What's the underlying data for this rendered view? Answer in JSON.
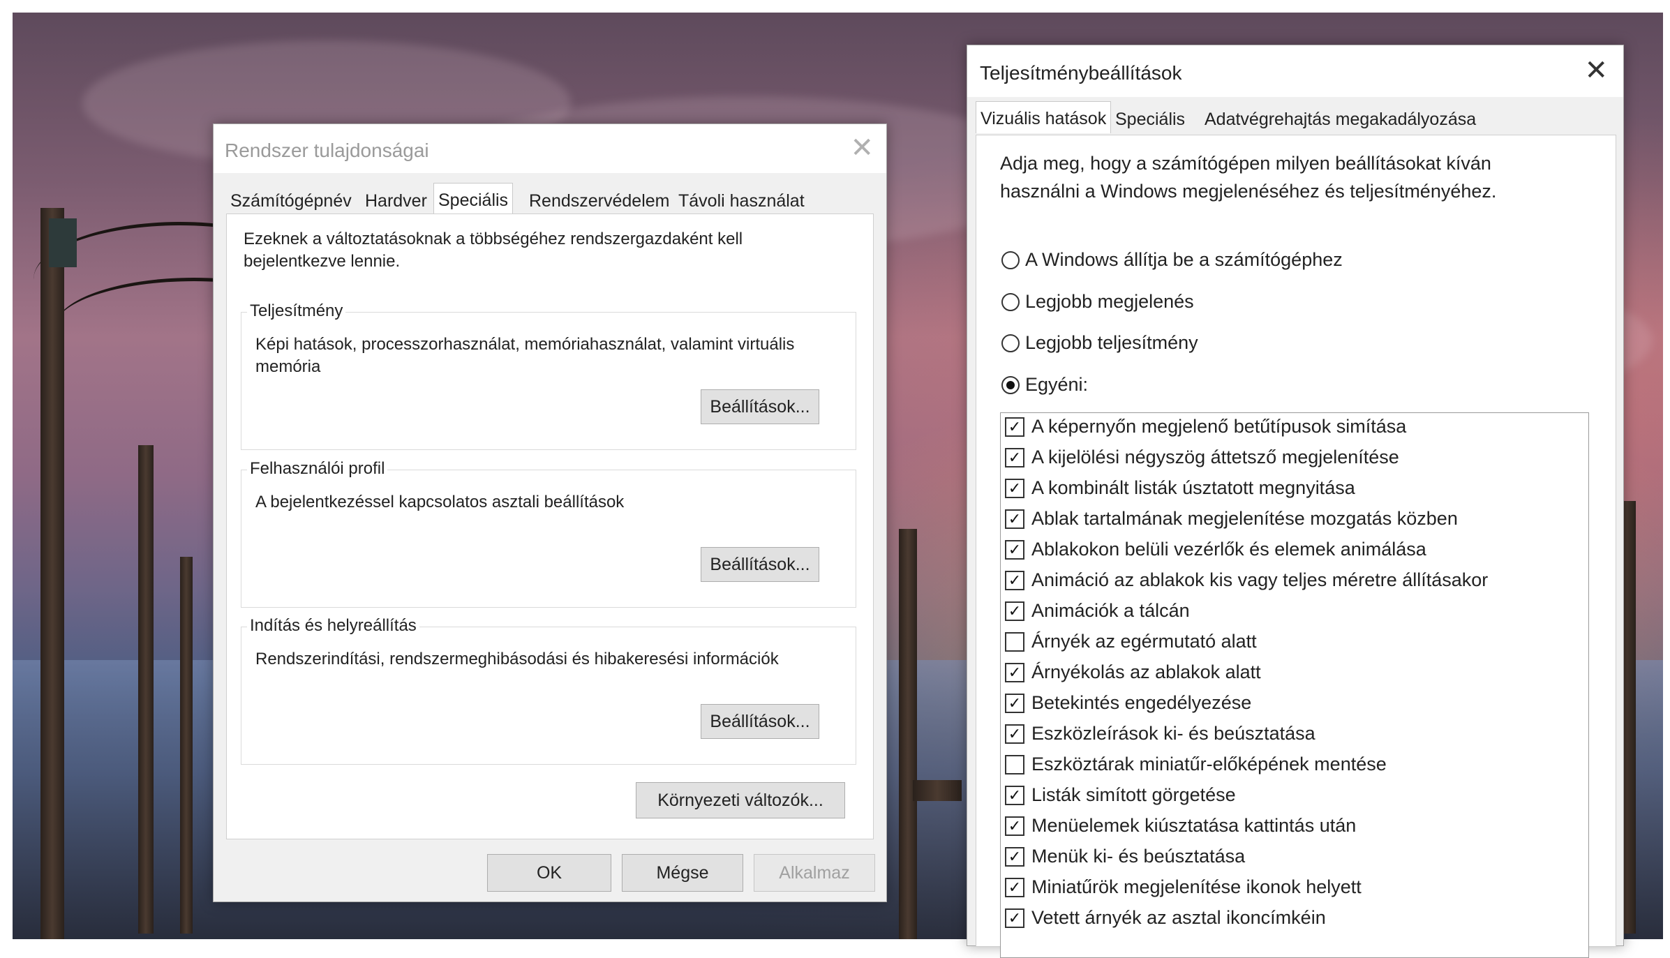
{
  "colors": {
    "dialog_bg": "#f0f0f0",
    "panel_bg": "#ffffff",
    "button_bg": "#e1e1e1",
    "disabled_text": "#a0a0a0"
  },
  "sysprops": {
    "title": "Rendszer tulajdonságai",
    "close_icon": "close-icon",
    "tabs": [
      {
        "label": "Számítógépnév"
      },
      {
        "label": "Hardver"
      },
      {
        "label": "Speciális"
      },
      {
        "label": "Rendszervédelem"
      },
      {
        "label": "Távoli használat"
      }
    ],
    "active_tab": "Speciális",
    "admin_note": "Ezeknek a változtatásoknak a többségéhez rendszergazdaként kell bejelentkezve lennie.",
    "performance": {
      "title": "Teljesítmény",
      "description": "Képi hatások, processzorhasználat, memóriahasználat, valamint virtuális memória",
      "button": "Beállítások..."
    },
    "profile": {
      "title": "Felhasználói profil",
      "description": "A bejelentkezéssel kapcsolatos asztali beállítások",
      "button": "Beállítások..."
    },
    "startup": {
      "title": "Indítás és helyreállítás",
      "description": "Rendszerindítási, rendszermeghibásodási és hibakeresési információk",
      "button": "Beállítások..."
    },
    "env_button": "Környezeti változók...",
    "ok": "OK",
    "cancel": "Mégse",
    "apply": "Alkalmaz"
  },
  "perf": {
    "title": "Teljesítménybeállítások",
    "close_icon": "close-icon",
    "tabs": [
      {
        "label": "Vizuális hatások"
      },
      {
        "label": "Speciális"
      },
      {
        "label": "Adatvégrehajtás megakadályozása"
      }
    ],
    "active_tab": "Vizuális hatások",
    "intro": "Adja meg, hogy a számítógépen milyen beállításokat kíván használni a Windows megjelenéséhez és teljesítményéhez.",
    "radios": [
      {
        "label": "A Windows állítja be a számítógéphez",
        "selected": false
      },
      {
        "label": "Legjobb megjelenés",
        "selected": false
      },
      {
        "label": "Legjobb teljesítmény",
        "selected": false
      },
      {
        "label": "Egyéni:",
        "selected": true
      }
    ],
    "options": [
      {
        "label": "A képernyőn megjelenő betűtípusok simítása",
        "checked": true
      },
      {
        "label": "A kijelölési négyszög áttetsző megjelenítése",
        "checked": true
      },
      {
        "label": "A kombinált listák úsztatott megnyitása",
        "checked": true
      },
      {
        "label": "Ablak tartalmának megjelenítése mozgatás közben",
        "checked": true
      },
      {
        "label": "Ablakokon belüli vezérlők és elemek animálása",
        "checked": true
      },
      {
        "label": "Animáció az ablakok kis vagy teljes méretre állításakor",
        "checked": true
      },
      {
        "label": "Animációk a tálcán",
        "checked": true
      },
      {
        "label": "Árnyék az egérmutató alatt",
        "checked": false
      },
      {
        "label": "Árnyékolás az ablakok alatt",
        "checked": true
      },
      {
        "label": "Betekintés engedélyezése",
        "checked": true
      },
      {
        "label": "Eszközleírások ki- és beúsztatása",
        "checked": true
      },
      {
        "label": "Eszköztárak miniatűr-előképének mentése",
        "checked": false
      },
      {
        "label": "Listák simított görgetése",
        "checked": true
      },
      {
        "label": "Menüelemek kiúsztatása kattintás után",
        "checked": true
      },
      {
        "label": "Menük ki- és beúsztatása",
        "checked": true
      },
      {
        "label": "Miniatűrök megjelenítése ikonok helyett",
        "checked": true
      },
      {
        "label": "Vetett árnyék az asztal ikoncímkéin",
        "checked": true
      }
    ]
  }
}
